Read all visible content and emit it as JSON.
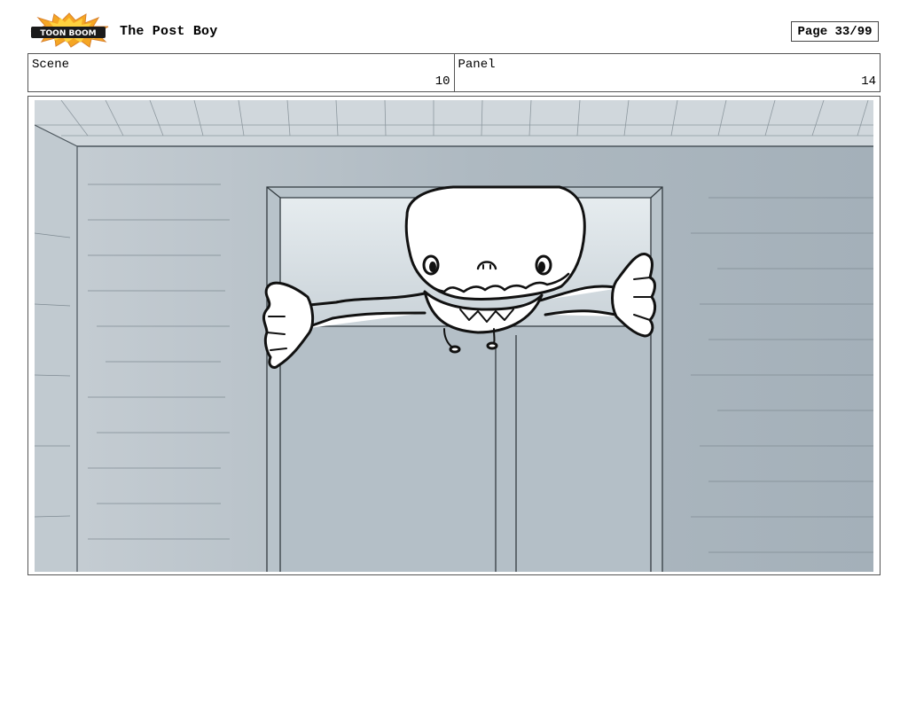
{
  "header": {
    "logo_text": "TOON BOOM",
    "title": "The Post Boy",
    "page": "Page 33/99"
  },
  "info": {
    "scene_label": "Scene",
    "scene_value": "10",
    "panel_label": "Panel",
    "panel_value": "14"
  },
  "panel_image": {
    "palette": {
      "wall": "#a9b5be",
      "wall_light": "#c7d0d6",
      "door": "#bac5cc",
      "ceiling": "#d2d9de",
      "line": "#111111"
    }
  }
}
